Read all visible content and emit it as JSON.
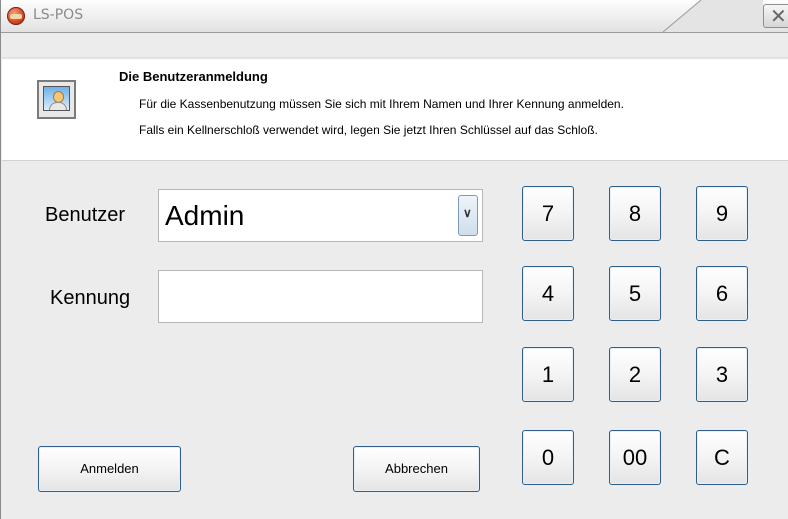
{
  "window": {
    "title": "LS-POS"
  },
  "header": {
    "title": "Die Benutzeranmeldung",
    "line1": "Für die Kassenbenutzung müssen Sie sich mit Ihrem Namen und Ihrer Kennung anmelden.",
    "line2": "Falls ein Kellnerschloß verwendet wird, legen Sie jetzt Ihren Schlüssel auf das Schloß."
  },
  "form": {
    "user_label": "Benutzer",
    "user_value": "Admin",
    "password_label": "Kennung",
    "password_value": ""
  },
  "buttons": {
    "login": "Anmelden",
    "cancel": "Abbrechen"
  },
  "keypad": {
    "k7": "7",
    "k8": "8",
    "k9": "9",
    "k4": "4",
    "k5": "5",
    "k6": "6",
    "k1": "1",
    "k2": "2",
    "k3": "3",
    "k0": "0",
    "k00": "00",
    "clear": "C"
  },
  "icons": {
    "app": "pos-app-icon",
    "header": "user-login-icon",
    "close": "close-icon",
    "dropdown": "chevron-down-icon"
  }
}
